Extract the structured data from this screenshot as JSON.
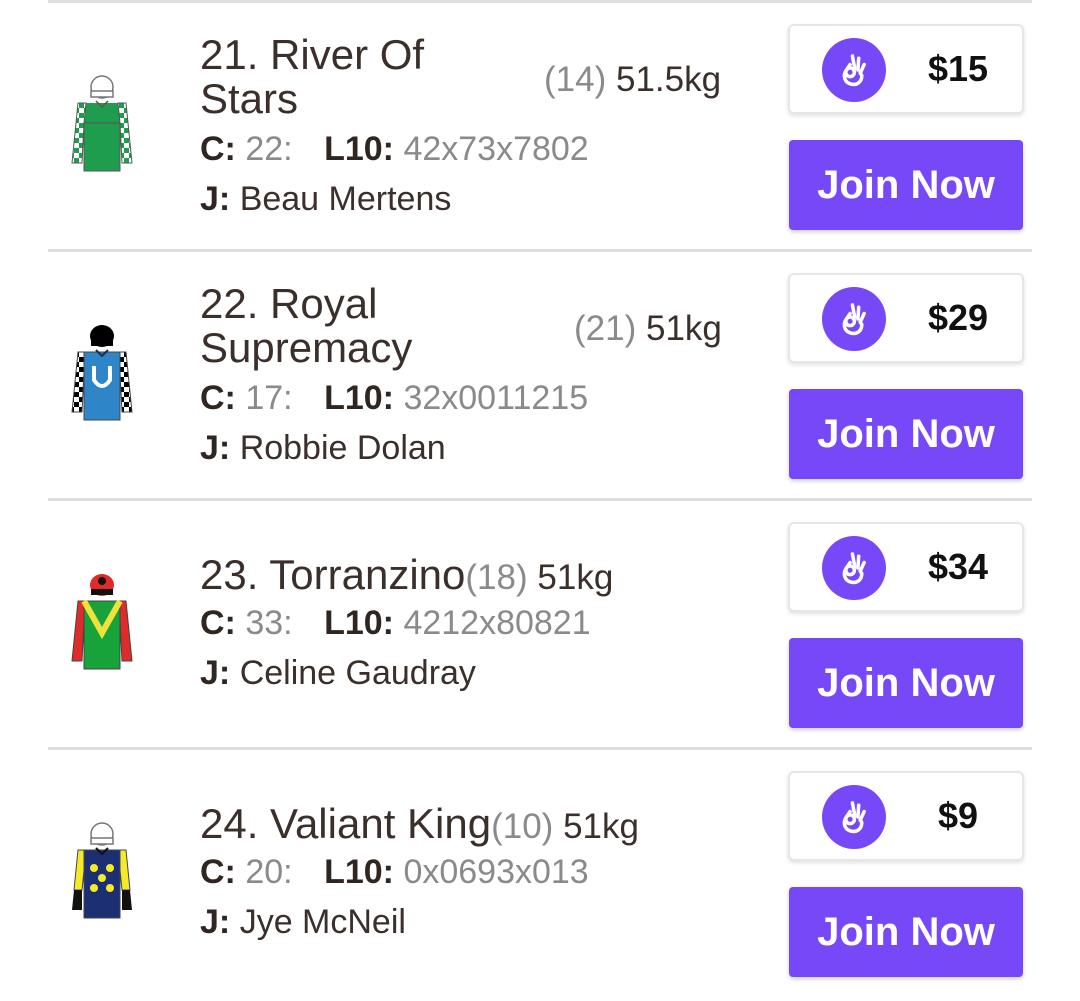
{
  "accent_color": "#7748f7",
  "runners": [
    {
      "name": "21. River Of Stars",
      "barrier": "(14)",
      "weight": "51.5kg",
      "comment_label": "C:",
      "comment_value": "22:",
      "last10_label": "L10:",
      "last10_value": "42x73x7802",
      "jockey_label": "J:",
      "jockey": "Beau Mertens",
      "odds": "$15",
      "odds_icon": "ok-hand-icon",
      "join_label": "Join Now"
    },
    {
      "name": "22. Royal Supremacy",
      "barrier": "(21)",
      "weight": "51kg",
      "comment_label": "C:",
      "comment_value": "17:",
      "last10_label": "L10:",
      "last10_value": "32x0011215",
      "jockey_label": "J:",
      "jockey": "Robbie Dolan",
      "odds": "$29",
      "odds_icon": "ok-hand-icon",
      "join_label": "Join Now"
    },
    {
      "name": "23. Torranzino",
      "barrier": "(18)",
      "weight": "51kg",
      "comment_label": "C:",
      "comment_value": "33:",
      "last10_label": "L10:",
      "last10_value": "4212x80821",
      "jockey_label": "J:",
      "jockey": "Celine Gaudray",
      "odds": "$34",
      "odds_icon": "ok-hand-icon",
      "join_label": "Join Now"
    },
    {
      "name": "24. Valiant King",
      "barrier": "(10)",
      "weight": "51kg",
      "comment_label": "C:",
      "comment_value": "20:",
      "last10_label": "L10:",
      "last10_value": "0x0693x013",
      "jockey_label": "J:",
      "jockey": "Jye McNeil",
      "odds": "$9",
      "odds_icon": "ok-hand-icon",
      "join_label": "Join Now"
    }
  ]
}
